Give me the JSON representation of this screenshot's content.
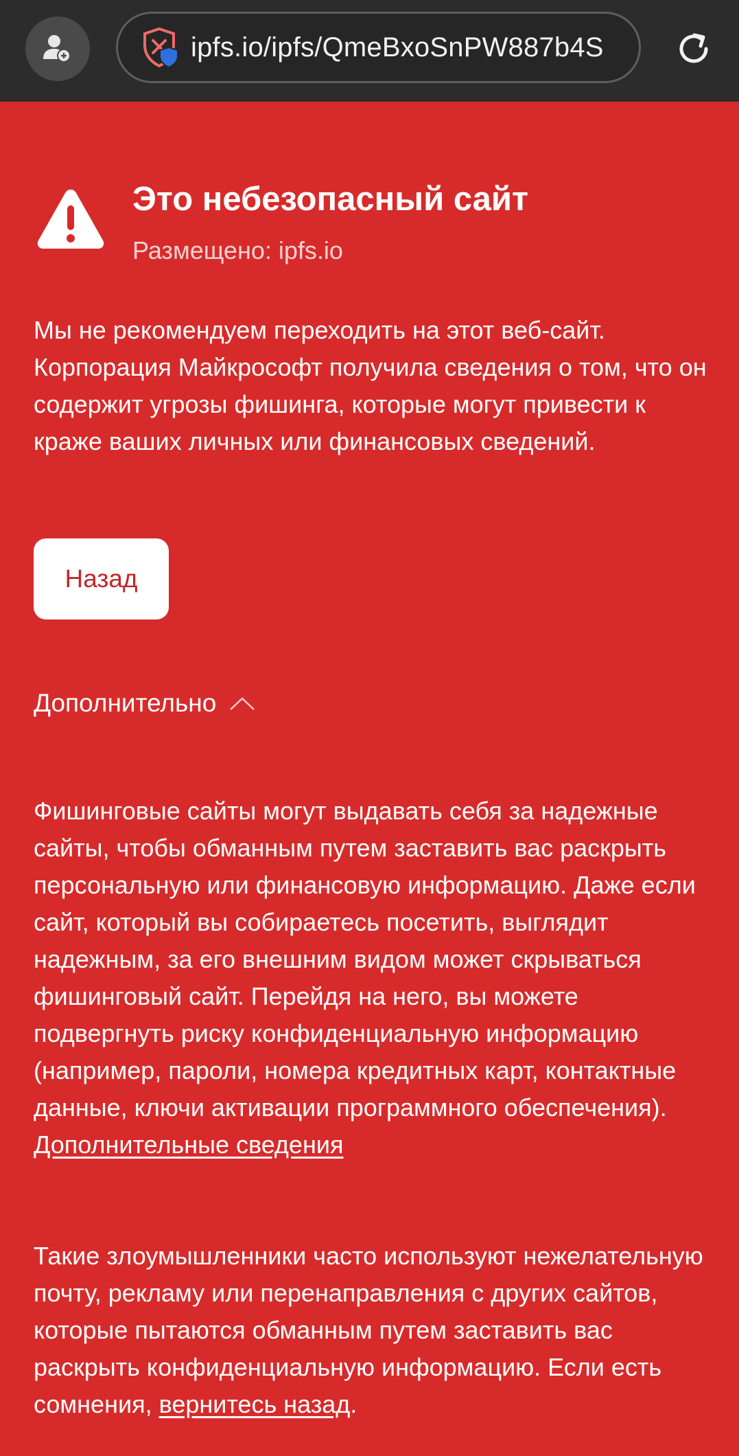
{
  "browser": {
    "url": "ipfs.io/ipfs/QmeBxoSnPW887b4S",
    "profile_icon": "add-profile-icon",
    "site_icon": "unsafe-shield-icon",
    "reload_icon": "reload-icon"
  },
  "warning": {
    "icon": "warning-triangle-icon",
    "title": "Это небезопасный сайт",
    "host_line": "Размещено: ipfs.io",
    "description": "Мы не рекомендуем переходить на этот веб-сайт. Корпорация Майкрософт получила сведения о том, что он содержит угрозы фишинга, которые могут привести к краже ваших личных или финансовых сведений.",
    "back_button": "Назад"
  },
  "advanced": {
    "label": "Дополнительно",
    "icon": "chevron-up-icon",
    "details_text": "Фишинговые сайты могут выдавать себя за надежные сайты, чтобы обманным путем заставить вас раскрыть персональную или финансовую информацию. Даже если сайт, который вы собираетесь посетить, выглядит надежным, за его внешним видом может скрываться фишинговый сайт. Перейдя на него, вы можете подвергнуть риску конфиденциальную информацию (например, пароли, номера кредитных карт, контактные данные, ключи активации программного обеспечения).",
    "details_link": "Дополнительные сведения",
    "followup_text": "Такие злоумышленники часто используют нежелательную почту, рекламу или перенаправления с других сайтов, которые пытаются обманным путем заставить вас раскрыть конфиденциальную информацию. Если есть сомнения,",
    "followup_link": "вернитесь назад",
    "followup_end": "."
  },
  "colors": {
    "page_background": "#d72b2b",
    "toolbar_background": "#2c2c2c",
    "button_text": "#c0282a",
    "shield_blue": "#2f6fe0"
  }
}
